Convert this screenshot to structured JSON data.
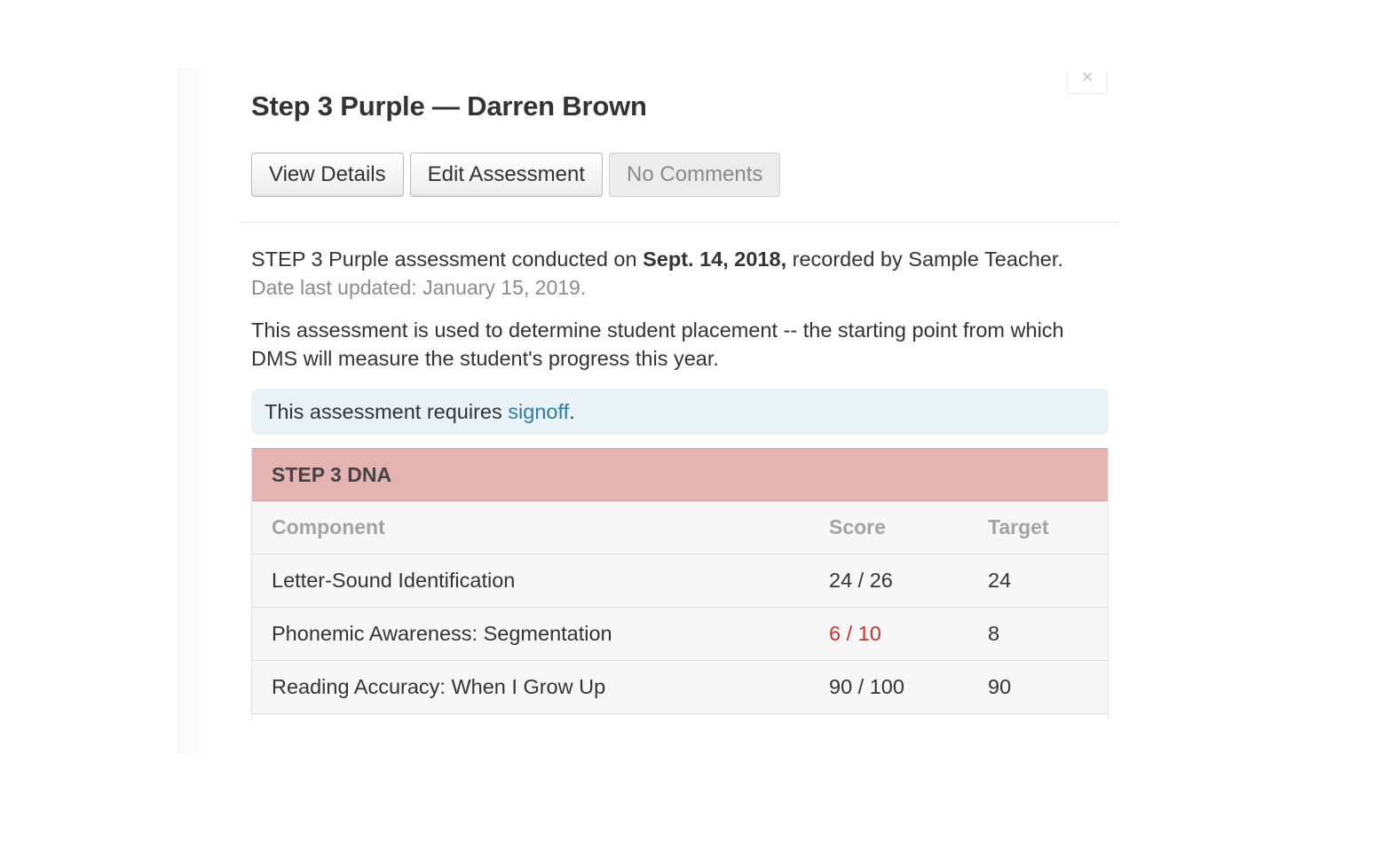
{
  "modal": {
    "close_label": "×",
    "title": "Step 3 Purple — Darren Brown",
    "buttons": {
      "view_details": "View Details",
      "edit_assessment": "Edit Assessment",
      "comments": "No Comments"
    },
    "summary": {
      "prefix": "STEP 3 Purple assessment conducted on ",
      "date": "Sept. 14, 2018,",
      "suffix": " recorded by Sample Teacher.",
      "last_updated": "Date last updated: January 15, 2019."
    },
    "placement_text": "This assessment is used to determine student placement -- the starting point from which DMS will measure the student's progress this year.",
    "signoff_notice": {
      "prefix": "This assessment requires ",
      "link": "signoff",
      "suffix": "."
    },
    "colors": {
      "table_header_bg": "#e6b3b3",
      "notice_bg": "#e9f2f6",
      "link": "#2c7cab",
      "below_target": "#d0312d"
    }
  },
  "table": {
    "section_title": "STEP 3 DNA",
    "columns": [
      "Component",
      "Score",
      "Target"
    ],
    "rows": [
      {
        "component": "Letter-Sound Identification",
        "score": "24 / 26",
        "target": "24",
        "below_target": false
      },
      {
        "component": "Phonemic Awareness: Segmentation",
        "score": "6 / 10",
        "target": "8",
        "below_target": true
      },
      {
        "component": "Reading Accuracy: When I Grow Up",
        "score": "90 / 100",
        "target": "90",
        "below_target": false
      }
    ]
  }
}
